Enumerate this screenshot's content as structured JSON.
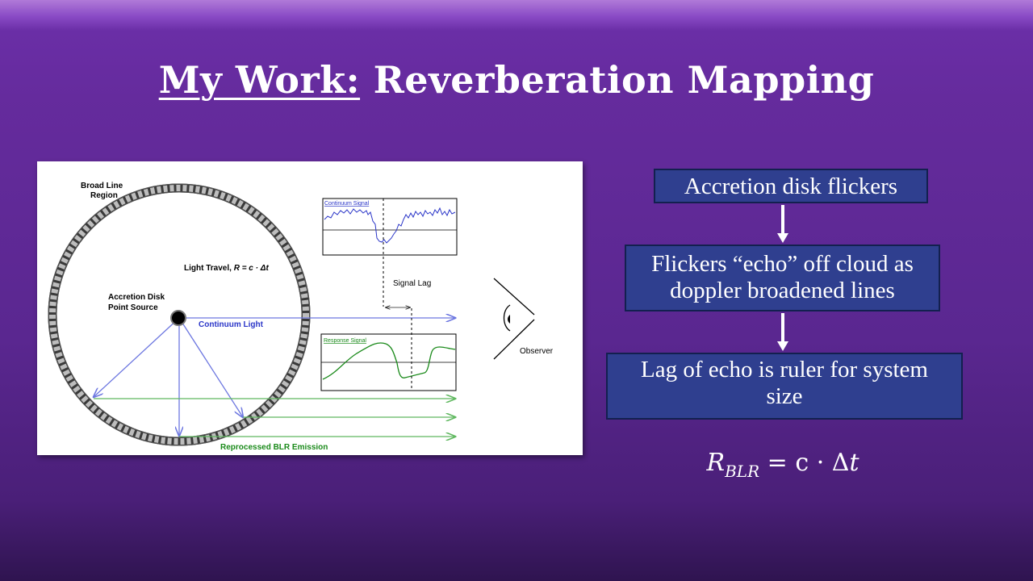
{
  "title": {
    "underlined": "My Work:",
    "rest": " Reverberation Mapping"
  },
  "diagram": {
    "blr_label_1": "Broad Line",
    "blr_label_2": "Region",
    "light_travel": "Light Travel, ",
    "light_travel_formula": "R = c · Δt",
    "disk_label_1": "Accretion Disk",
    "disk_label_2": "Point Source",
    "continuum_light": "Continuum Light",
    "continuum_signal": "Continuum Signal",
    "response_signal": "Response Signal",
    "signal_lag": "Signal Lag",
    "observer": "Observer",
    "reprocessed": "Reprocessed BLR Emission",
    "colors": {
      "blue": "#2a35c8",
      "green": "#1a8a1a",
      "light_blue": "#7b86e6",
      "light_green": "#6fbf6f"
    }
  },
  "flow": {
    "step1": "Accretion disk flickers",
    "step2_line1": "Flickers “echo” off cloud as",
    "step2_line2": "doppler broadened lines",
    "step3_line1": "Lag of  echo is ruler for system",
    "step3_line2": "size"
  },
  "formula": {
    "r": "R",
    "sub": "BLR",
    "rhs": " = c · Δ",
    "t": "t"
  }
}
